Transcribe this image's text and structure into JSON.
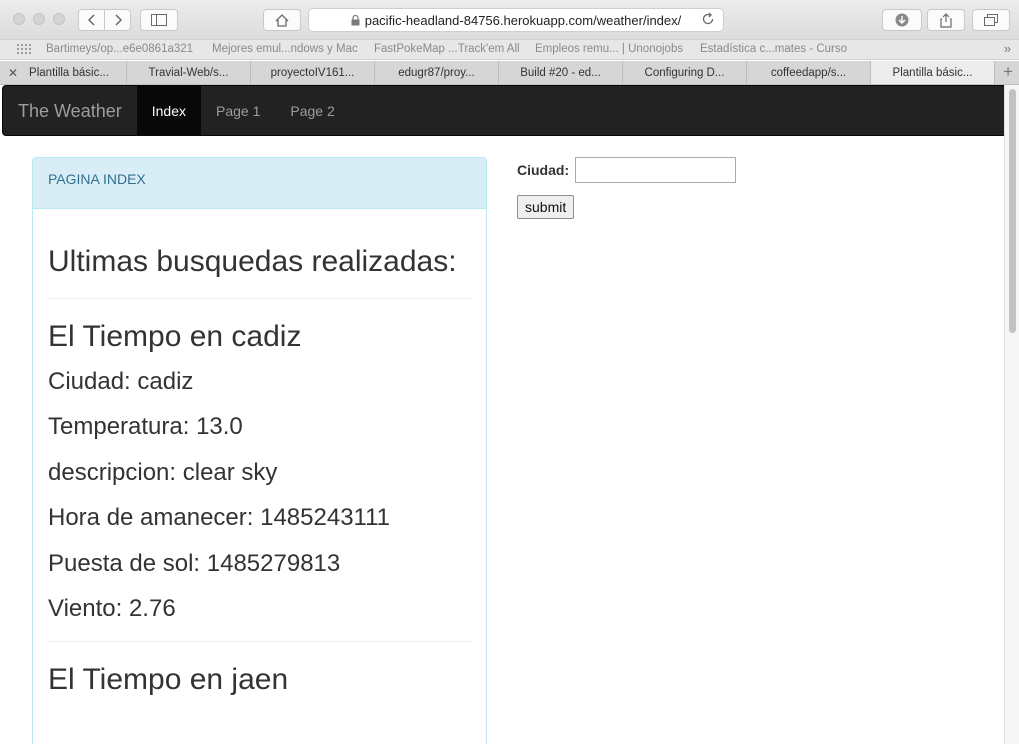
{
  "browser": {
    "url": "pacific-headland-84756.herokuapp.com/weather/index/",
    "bookmarks": [
      "Bartimeys/op...e6e0861a321",
      "Mejores emul...ndows y Mac",
      "FastPokeMap ...Track'em All",
      "Empleos remu... | Unonojobs",
      "Estadística c...mates - Curso"
    ],
    "tabs": [
      "Plantilla básic...",
      "Travial-Web/s...",
      "proyectoIV161...",
      "edugr87/proy...",
      "Build #20 - ed...",
      "Configuring D...",
      "coffeedapp/s...",
      "Plantilla básic..."
    ],
    "active_tab_index": 7
  },
  "navbar": {
    "brand": "The Weather",
    "links": [
      "Index",
      "Page 1",
      "Page 2"
    ],
    "active_link_index": 0
  },
  "panel": {
    "heading": "PAGINA INDEX",
    "title": "Ultimas busquedas realizadas:",
    "results": [
      {
        "title": "El Tiempo en cadiz",
        "ciudad": "Ciudad: cadiz",
        "temperatura": "Temperatura: 13.0",
        "descripcion": "descripcion: clear sky",
        "amanecer": "Hora de amanecer: 1485243111",
        "puesta": "Puesta de sol: 1485279813",
        "viento": "Viento: 2.76"
      },
      {
        "title": "El Tiempo en jaen"
      }
    ]
  },
  "form": {
    "label": "Ciudad:",
    "value": "",
    "submit_label": "submit"
  }
}
